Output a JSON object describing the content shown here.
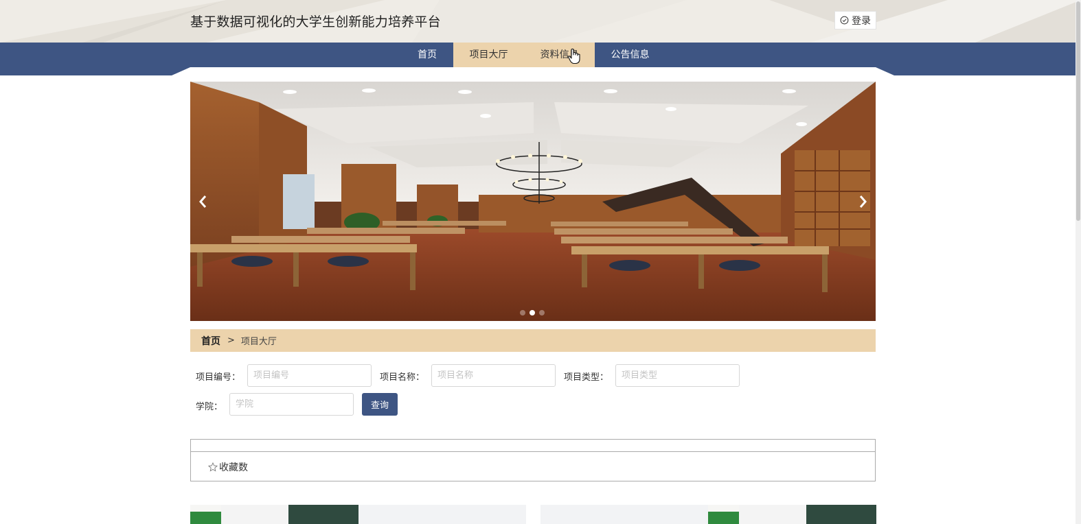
{
  "header": {
    "title": "基于数据可视化的大学生创新能力培养平台",
    "login_label": "登录"
  },
  "nav": {
    "items": [
      {
        "label": "首页",
        "active": false
      },
      {
        "label": "项目大厅",
        "active": true
      },
      {
        "label": "资料信息",
        "active": false
      },
      {
        "label": "公告信息",
        "active": false
      }
    ]
  },
  "carousel": {
    "slide_count": 3,
    "active_index": 1
  },
  "breadcrumb": {
    "home": "首页",
    "separator": ">",
    "current": "项目大厅"
  },
  "search": {
    "fields": [
      {
        "label": "项目编号：",
        "placeholder": "项目编号",
        "value": ""
      },
      {
        "label": "项目名称：",
        "placeholder": "项目名称",
        "value": ""
      },
      {
        "label": "项目类型：",
        "placeholder": "项目类型",
        "value": ""
      },
      {
        "label": "学院：",
        "placeholder": "学院",
        "value": ""
      }
    ],
    "button_label": "查询"
  },
  "sort": {
    "favorites_label": "收藏数"
  },
  "icons": {
    "login": "check-circle-icon",
    "prev": "chevron-left-icon",
    "next": "chevron-right-icon",
    "sort": "star-icon"
  },
  "colors": {
    "nav_bg": "#3e5583",
    "accent": "#ecd3ac",
    "button": "#3e5583"
  }
}
